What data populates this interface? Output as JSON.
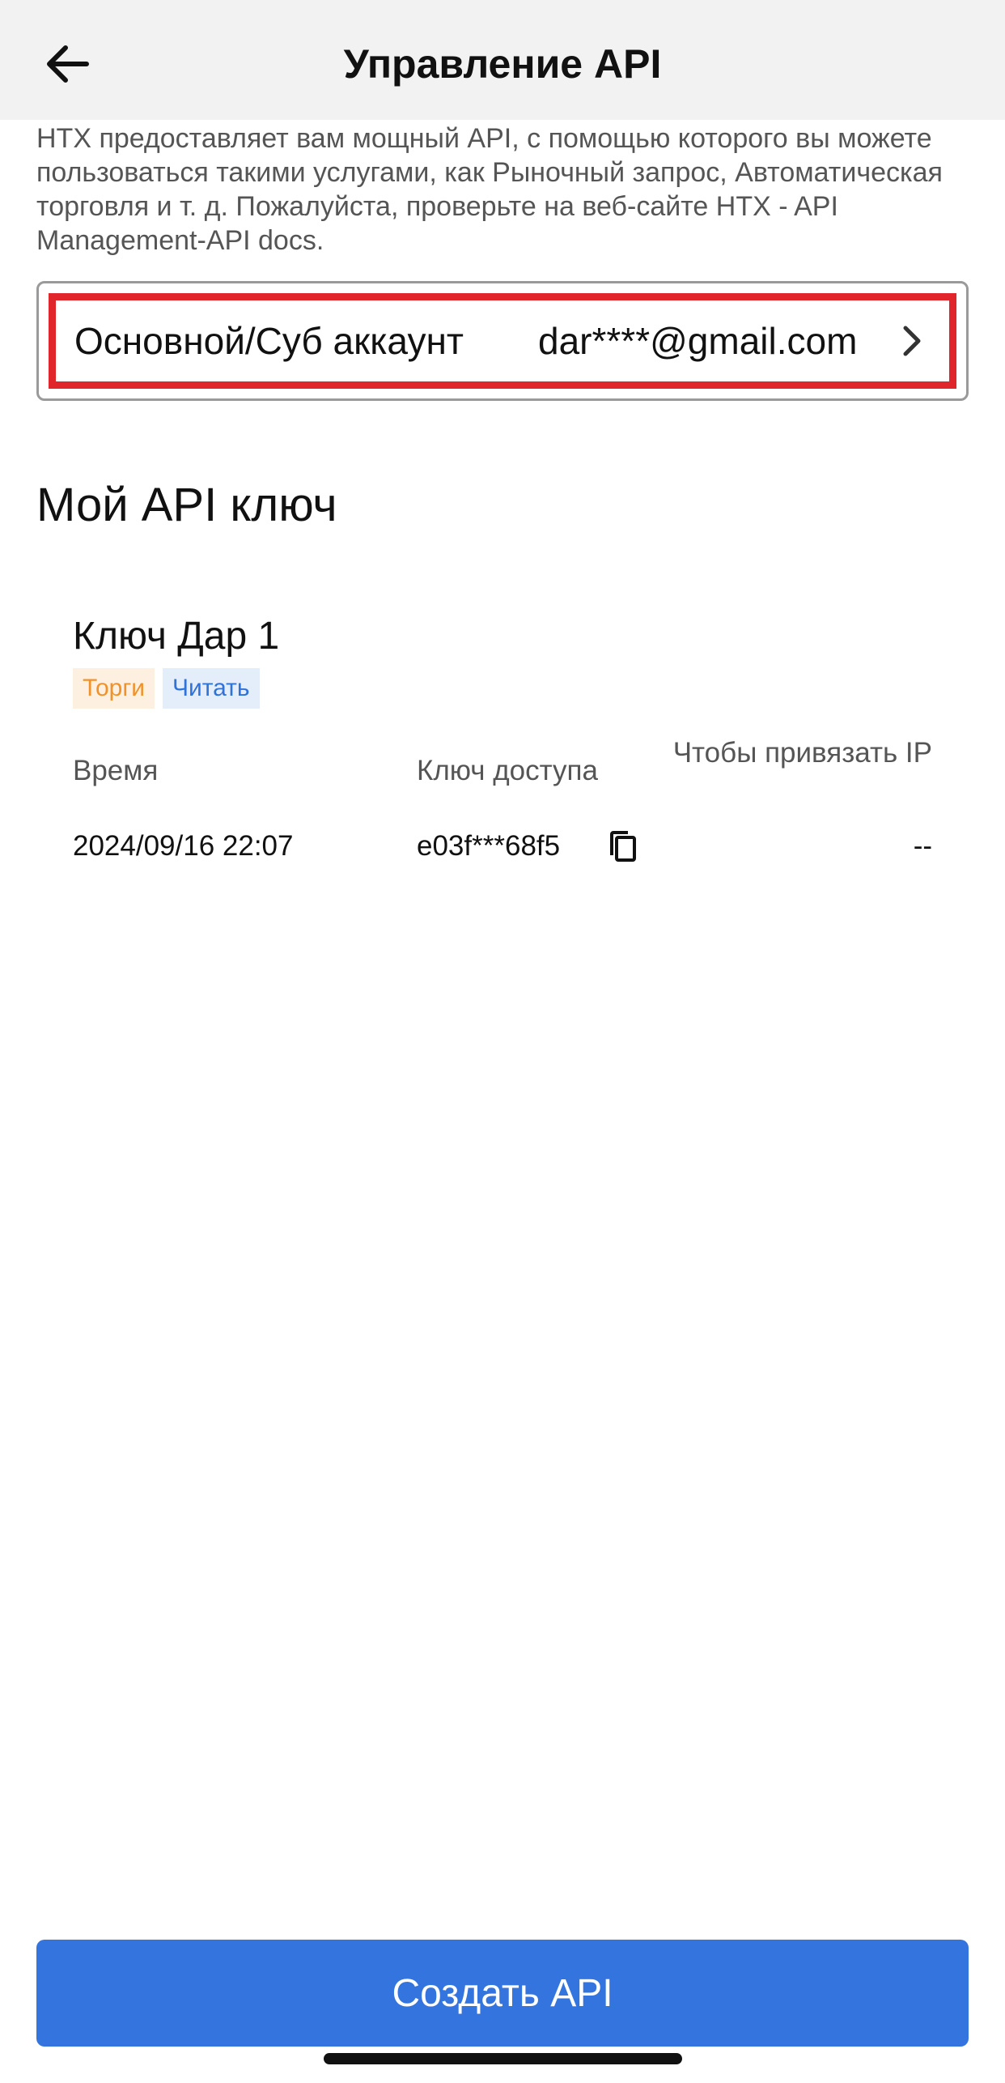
{
  "header": {
    "title": "Управление API",
    "back_icon": "arrow-left-icon"
  },
  "description": "HTX предоставляет вам мощный API, с помощью которого вы можете пользоваться такими услугами, как Рыночный запрос, Автоматическая торговля и т. д. Пожалуйста, проверьте на веб-сайте HTX - API Management-API docs.",
  "account": {
    "label": "Основной/Суб аккаунт",
    "value": "dar****@gmail.com",
    "chevron_icon": "chevron-right-icon",
    "highlight_color": "#e0262a"
  },
  "section": {
    "title": "Мой API ключ"
  },
  "api_key": {
    "name": "Ключ Дар 1",
    "tags": [
      "Торги",
      "Читать"
    ],
    "columns": {
      "time": "Время",
      "access_key": "Ключ доступа",
      "bind_ip": "Чтобы привязать IP"
    },
    "time": "2024/09/16 22:07",
    "access_key": "e03f***68f5",
    "bind_ip": "--",
    "copy_icon": "copy-icon"
  },
  "footer": {
    "create_button": "Создать API",
    "button_color": "#3474de"
  }
}
